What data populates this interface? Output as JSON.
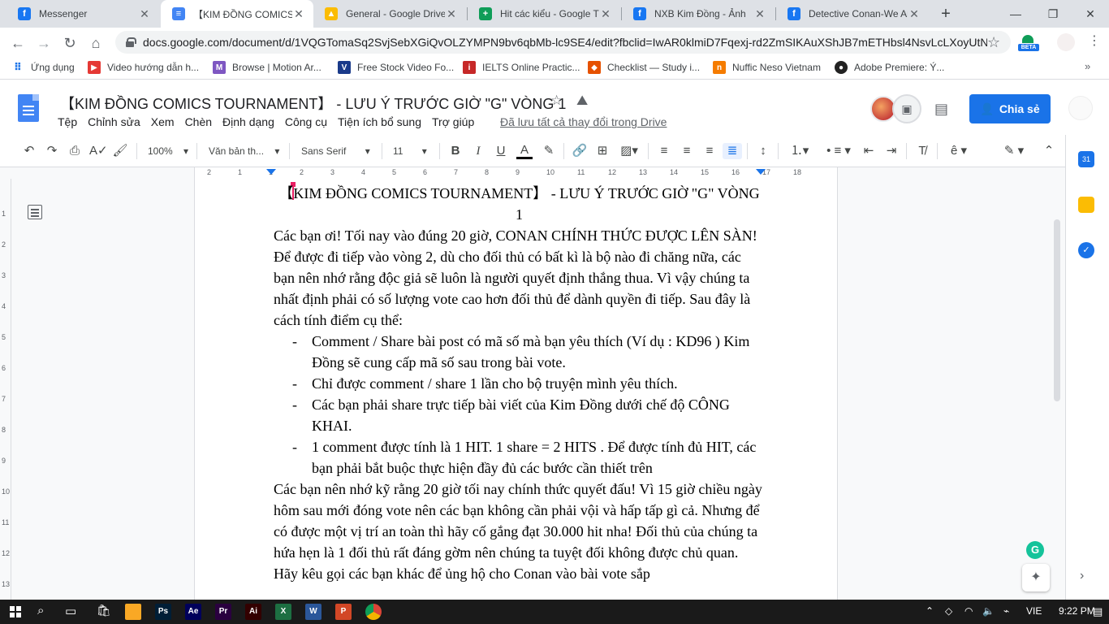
{
  "browser": {
    "tabs": [
      {
        "label": "Messenger",
        "icon": "facebook-icon",
        "color": "#1877f2"
      },
      {
        "label": "【KIM ĐỒNG COMICS TO",
        "icon": "docs-icon",
        "color": "#4285f4",
        "active": true
      },
      {
        "label": "General - Google Drive",
        "icon": "drive-icon",
        "color": "#fbbc04"
      },
      {
        "label": "Hit các kiểu - Google Tr",
        "icon": "sheets-icon",
        "color": "#0f9d58"
      },
      {
        "label": "NXB Kim Đồng - Ảnh",
        "icon": "facebook-icon",
        "color": "#1877f2"
      },
      {
        "label": "Detective Conan-We Ar",
        "icon": "facebook-icon",
        "color": "#1877f2"
      }
    ],
    "new_tab": "+",
    "url": "docs.google.com/document/d/1VQGTomaSq2SvjSebXGiQvOLZYMPN9bv6qbMb-lc9SE4/edit?fbclid=IwAR0klmiD7Fqexj-rd2ZmSIKAuXShJB7mETHbsl4NsvLcLXoyUtN...",
    "ext_badge": "BETA",
    "bookmarks": [
      {
        "label": "Ứng dụng",
        "icon": "apps-grid-icon",
        "color": "#5f6368"
      },
      {
        "label": "Video hướng dẫn h...",
        "icon": "bookmark-icon",
        "color": "#e53935"
      },
      {
        "label": "Browse | Motion Ar...",
        "icon": "motion-array-icon",
        "color": "#7e57c2"
      },
      {
        "label": "Free Stock Video Fo...",
        "icon": "v-logo-icon",
        "color": "#1a3a8a"
      },
      {
        "label": "IELTS Online Practic...",
        "icon": "ielts-icon",
        "color": "#c62828"
      },
      {
        "label": "Checklist — Study i...",
        "icon": "checklist-icon",
        "color": "#e65100"
      },
      {
        "label": "Nuffic Neso Vietnam",
        "icon": "nuffic-icon",
        "color": "#f57c00"
      },
      {
        "label": "Adobe Premiere: Ý...",
        "icon": "adobe-icon",
        "color": "#222222"
      }
    ]
  },
  "docs": {
    "title": "【KIM ĐỒNG COMICS TOURNAMENT】 - LƯU Ý TRƯỚC GIỜ \"G\" VÒNG 1",
    "menu": [
      "Tệp",
      "Chỉnh sửa",
      "Xem",
      "Chèn",
      "Định dạng",
      "Công cụ",
      "Tiện ích bổ sung",
      "Trợ giúp"
    ],
    "save_status": "Đã lưu tất cả thay đổi trong Drive",
    "share_label": "Chia sẻ",
    "toolbar": {
      "zoom": "100%",
      "style": "Văn bản th...",
      "font": "Sans Serif",
      "size": "11"
    },
    "accent": "#1a73e8",
    "ruler_numbers": [
      "2",
      "1",
      "1",
      "2",
      "3",
      "4",
      "5",
      "6",
      "7",
      "8",
      "9",
      "10",
      "11",
      "12",
      "13",
      "14",
      "15",
      "16",
      "17",
      "18"
    ],
    "vruler_numbers": [
      "1",
      "2",
      "3",
      "4",
      "5",
      "6",
      "7",
      "8",
      "9",
      "10",
      "11",
      "12",
      "13"
    ]
  },
  "content": {
    "heading": "【KIM ĐỒNG COMICS TOURNAMENT】 - LƯU Ý TRƯỚC GIỜ \"G\" VÒNG 1",
    "p1": " Các bạn ơi! Tối nay vào đúng 20 giờ, CONAN CHÍNH THỨC ĐƯỢC LÊN SÀN!",
    "p2": " Để được đi tiếp vào vòng 2, dù cho đối thủ có bất kì là bộ nào đi chăng nữa, các bạn nên nhớ rằng độc giả sẽ luôn là người quyết định thắng thua. Vì vậy  chúng ta nhất định phải có số lượng vote cao hơn đối thủ để dành quyền đi tiếp. Sau đây là cách tính điểm cụ thể:",
    "bullets": [
      "Comment / Share bài post có mã số mà bạn yêu thích (Ví dụ : KD96 ) Kim Đồng sẽ cung cấp mã số sau trong bài vote.",
      "Chỉ được comment / share 1 lần cho bộ truyện mình yêu thích.",
      "Các bạn phải share trực tiếp bài viết của Kim Đồng dưới chế độ CÔNG KHAI.",
      "1 comment được tính là 1 HIT. 1 share = 2 HITS . Để được tính đủ HIT, các bạn phải bắt buộc thực hiện đầy đủ các bước cần thiết trên"
    ],
    "p3": " Các bạn nên nhớ kỹ rằng 20 giờ tối nay chính thức quyết đấu! Vì 15 giờ chiều ngày hôm sau mới đóng vote nên các bạn không cần phải vội và hấp tấp gì cả. Nhưng để có được một vị trí an toàn thì hãy cố gắng đạt 30.000 hit nha! Đối thủ của chúng ta hứa hẹn là 1 đối thủ rất đáng gờm nên chúng ta tuyệt đối không được chủ quan. Hãy kêu gọi các bạn khác để ủng hộ cho Conan vào bài vote sắp"
  },
  "taskbar": {
    "lang": "VIE",
    "time": "9:22 PM",
    "apps": [
      {
        "name": "file-explorer-icon",
        "color": "#f9a825",
        "label": ""
      },
      {
        "name": "photoshop-icon",
        "color": "#001e36",
        "label": "Ps"
      },
      {
        "name": "after-effects-icon",
        "color": "#00005b",
        "label": "Ae"
      },
      {
        "name": "premiere-icon",
        "color": "#2a003f",
        "label": "Pr"
      },
      {
        "name": "illustrator-icon",
        "color": "#330000",
        "label": "Ai"
      },
      {
        "name": "excel-icon",
        "color": "#1d6f42",
        "label": "X"
      },
      {
        "name": "word-icon",
        "color": "#2b579a",
        "label": "W"
      },
      {
        "name": "powerpoint-icon",
        "color": "#d24726",
        "label": "P"
      },
      {
        "name": "chrome-icon",
        "color": "#db4437",
        "label": ""
      }
    ]
  }
}
